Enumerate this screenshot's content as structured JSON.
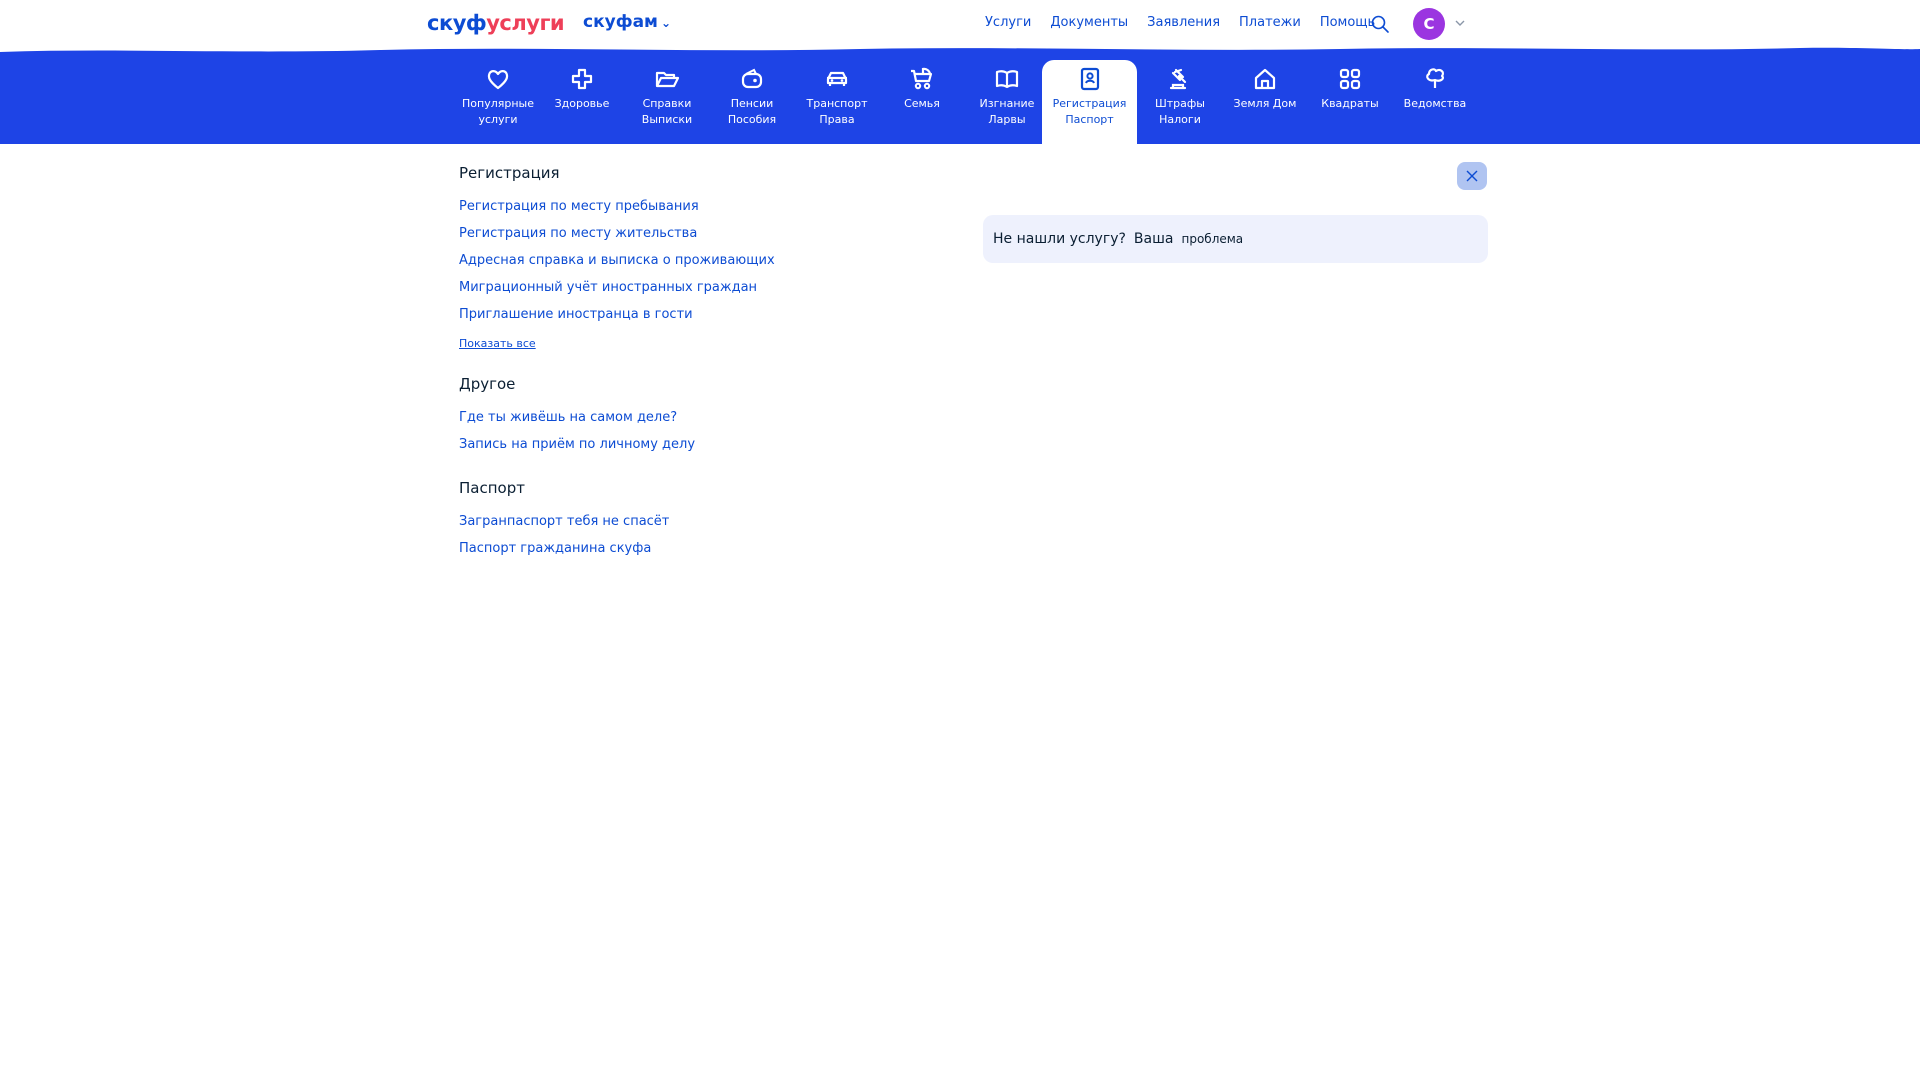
{
  "header": {
    "logo_part1": "скуф",
    "logo_part2": "услуги",
    "region": "скуфам",
    "nav": [
      "Услуги",
      "Документы",
      "Заявления",
      "Платежи",
      "Помощь"
    ],
    "avatar_letter": "С"
  },
  "categories": [
    {
      "label": "Популярные услуги",
      "icon": "heart-icon"
    },
    {
      "label": "Здоровье",
      "icon": "medical-cross-icon"
    },
    {
      "label": "Справки Выписки",
      "icon": "folder-icon"
    },
    {
      "label": "Пенсии Пособия",
      "icon": "wallet-icon"
    },
    {
      "label": "Транспорт Права",
      "icon": "car-icon"
    },
    {
      "label": "Семья",
      "icon": "stroller-icon"
    },
    {
      "label": "Изгнание Ларвы",
      "icon": "book-icon"
    },
    {
      "label": "Регистрация Паспорт",
      "icon": "passport-icon",
      "active": true
    },
    {
      "label": "Штрафы Налоги",
      "icon": "gavel-icon"
    },
    {
      "label": "Земля Дом",
      "icon": "house-icon"
    },
    {
      "label": "Квадраты",
      "icon": "grid-squares-icon"
    },
    {
      "label": "Ведомства",
      "icon": "tree-icon"
    }
  ],
  "groups": [
    {
      "title": "Регистрация",
      "links": [
        "Регистрация по месту пребывания",
        "Регистрация по месту жительства",
        "Адресная справка и выписка о проживающих",
        "Миграционный учёт иностранных граждан",
        "Приглашение иностранца в гости"
      ],
      "show_all": "Показать все"
    },
    {
      "title": "Другое",
      "links": [
        "Где ты живёшь на самом деле?",
        "Запись на приём по личному делу"
      ]
    },
    {
      "title": "Паспорт",
      "links": [
        "Загранпаспорт тебя не спасёт",
        "Паспорт гражданина скуфа"
      ]
    }
  ],
  "notfound": {
    "part1": "Не нашли услугу?",
    "part2": "Ваша",
    "part3": "проблема"
  },
  "colors": {
    "brand_blue": "#0d4cd3",
    "band_blue": "#1e44e6",
    "logo_red": "#ee3f58",
    "avatar": "#9b35e0",
    "notfound_bg": "#eef1fd",
    "close_bg": "#b0c4f1"
  }
}
